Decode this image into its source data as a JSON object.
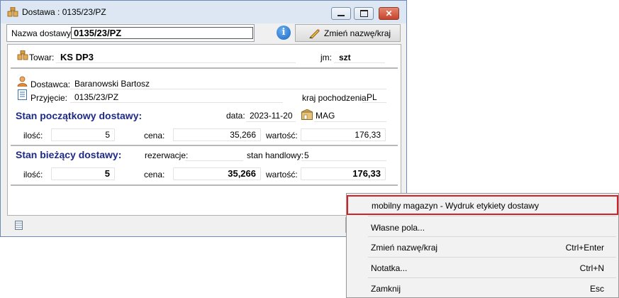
{
  "window": {
    "title": "Dostawa : 0135/23/PZ"
  },
  "toolbar": {
    "name_label": "Nazwa dostawy:",
    "name_value": "0135/23/PZ",
    "info_glyph": "i",
    "rename_button": "Zmień nazwę/kraj"
  },
  "product": {
    "label": "Towar:",
    "value": "KS DP3",
    "unit_label": "jm:",
    "unit_value": "szt"
  },
  "supplier": {
    "label": "Dostawca:",
    "value": "Baranowski Bartosz"
  },
  "receipt": {
    "label": "Przyjęcie:",
    "value": "0135/23/PZ",
    "origin_label": "kraj pochodzenia:",
    "origin_value": "PL"
  },
  "initial_state": {
    "heading": "Stan początkowy dostawy:",
    "date_label": "data:",
    "date_value": "2023-11-20",
    "warehouse": "MAG",
    "qty_label": "ilość:",
    "qty": "5",
    "price_label": "cena:",
    "price": "35,266",
    "value_label": "wartość:",
    "value": "176,33"
  },
  "current_state": {
    "heading": "Stan bieżący dostawy:",
    "reservation_label": "rezerwacje:",
    "reservation_value": "",
    "trade_label": "stan handlowy:",
    "trade_value": "5",
    "qty_label": "ilość:",
    "qty": "5",
    "price_label": "cena:",
    "price": "35,266",
    "value_label": "wartość:",
    "value": "176,33"
  },
  "context_menu": {
    "items": [
      {
        "label": "mobilny magazyn - Wydruk etykiety dostawy",
        "shortcut": ""
      },
      {
        "label": "Własne pola...",
        "shortcut": ""
      },
      {
        "label": "Zmień nazwę/kraj",
        "shortcut": "Ctrl+Enter"
      },
      {
        "label": "Notatka...",
        "shortcut": "Ctrl+N"
      },
      {
        "label": "Zamknij",
        "shortcut": "Esc"
      }
    ],
    "highlight_color": "#d61f26"
  },
  "icons": [
    "boxes-icon",
    "minimize-icon",
    "maximize-icon",
    "close-icon",
    "info-icon",
    "pencil-icon",
    "person-icon",
    "document-icon",
    "warehouse-icon",
    "note-icon"
  ],
  "colors": {
    "heading": "#1e2a86",
    "titlebar": "#dde7f3",
    "close_button": "#c7432c"
  }
}
